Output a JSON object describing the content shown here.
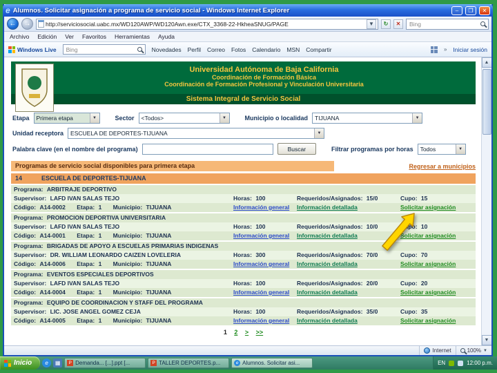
{
  "window": {
    "title": "Alumnos. Solicitar asignación a programa de servicio social - Windows Internet Explorer"
  },
  "browser": {
    "url": "http://serviciosocial.uabc.mx/WD120AWP/WD120Awn.exe/CTX_3368-22-HkheaSNUG/PAGE",
    "search_placeholder": "Bing",
    "menu": [
      "Archivo",
      "Edición",
      "Ver",
      "Favoritos",
      "Herramientas",
      "Ayuda"
    ],
    "live": {
      "brand": "Windows Live",
      "search_placeholder": "Bing",
      "items": [
        "Novedades",
        "Perfil",
        "Correo",
        "Fotos",
        "Calendario",
        "MSN",
        "Compartir"
      ],
      "sign_in": "Iniciar sesión"
    }
  },
  "banner": {
    "line1": "Universidad Autónoma de Baja California",
    "line2": "Coordinación de Formación Básica",
    "line3": "Coordinación de Formación Profesional y Vinculación Universitaria",
    "line4": "Sistema Integral de Servicio Social"
  },
  "filters": {
    "etapa_label": "Etapa",
    "etapa_value": "Primera etapa",
    "sector_label": "Sector",
    "sector_value": "<Todos>",
    "municipio_label": "Municipio o localidad",
    "municipio_value": "TIJUANA",
    "unidad_label": "Unidad receptora",
    "unidad_value": "ESCUELA DE DEPORTES-TIJUANA",
    "keyword_label": "Palabra clave (en el nombre del programa)",
    "buscar_button": "Buscar",
    "horas_label": "Filtrar programas por horas",
    "horas_value": "Todos"
  },
  "results": {
    "header": "Programas de servicio social disponibles para primera etapa",
    "back_link": "Regresar a municipios",
    "unit_id": "14",
    "unit_name": "ESCUELA DE DEPORTES-TIJUANA",
    "labels": {
      "programa": "Programa:",
      "supervisor": "Supervisor:",
      "horas": "Horas:",
      "requeridos": "Requeridos/Asignados:",
      "cupo": "Cupo:",
      "codigo": "Código:",
      "etapa": "Etapa:",
      "municipio": "Municipio:"
    },
    "links": {
      "general": "Información general",
      "detallada": "Información detallada",
      "solicitar": "Solicitar asignación"
    },
    "programs": [
      {
        "name": "ARBITRAJE DEPORTIVO",
        "supervisor": "LAFD IVAN SALAS TEJO",
        "horas": "100",
        "requeridos": "15/0",
        "cupo": "15",
        "codigo": "A14-0002",
        "etapa": "1",
        "municipio": "TIJUANA"
      },
      {
        "name": "PROMOCION DEPORTIVA UNIVERSITARIA",
        "supervisor": "LAFD IVAN SALAS TEJO",
        "horas": "100",
        "requeridos": "10/0",
        "cupo": "10",
        "codigo": "A14-0001",
        "etapa": "1",
        "municipio": "TIJUANA"
      },
      {
        "name": "BRIGADAS DE APOYO A ESCUELAS PRIMARIAS INDIGENAS",
        "supervisor": "DR. WILLIAM LEONARDO CAIZEN LOVELERIA",
        "horas": "300",
        "requeridos": "70/0",
        "cupo": "70",
        "codigo": "A14-0006",
        "etapa": "1",
        "municipio": "TIJUANA"
      },
      {
        "name": "EVENTOS ESPECIALES DEPORTIVOS",
        "supervisor": "LAFD IVAN SALAS TEJO",
        "horas": "100",
        "requeridos": "20/0",
        "cupo": "20",
        "codigo": "A14-0004",
        "etapa": "1",
        "municipio": "TIJUANA"
      },
      {
        "name": "EQUIPO DE COORDINACION Y STAFF DEL PROGRAMA",
        "supervisor": "LIC. JOSE ANGEL GOMEZ CEJA",
        "horas": "100",
        "requeridos": "35/0",
        "cupo": "35",
        "codigo": "A14-0005",
        "etapa": "1",
        "municipio": "TIJUANA"
      }
    ],
    "pagination": [
      "1",
      "2",
      ">",
      ">>"
    ]
  },
  "statusbar": {
    "zone": "Internet",
    "zoom": "100%"
  },
  "taskbar": {
    "start": "Inicio",
    "tasks": [
      "Demanda... [...].ppt [...",
      "TALLER DEPORTES.p...",
      "Alumnos. Solicitar asi..."
    ],
    "tray_lang": "EN",
    "clock": "12:00 p.m."
  },
  "colors": {
    "uabc_green": "#006b3c",
    "banner_gold": "#f5c63f",
    "header_orange": "#f6b877",
    "unit_orange": "#f0a35e",
    "row_green_light": "#ebf4e3",
    "row_green_dark": "#dde9d0",
    "link_blue": "#2a49c8",
    "link_green": "#1e8a1e",
    "arrow_yellow": "#ffd500"
  }
}
